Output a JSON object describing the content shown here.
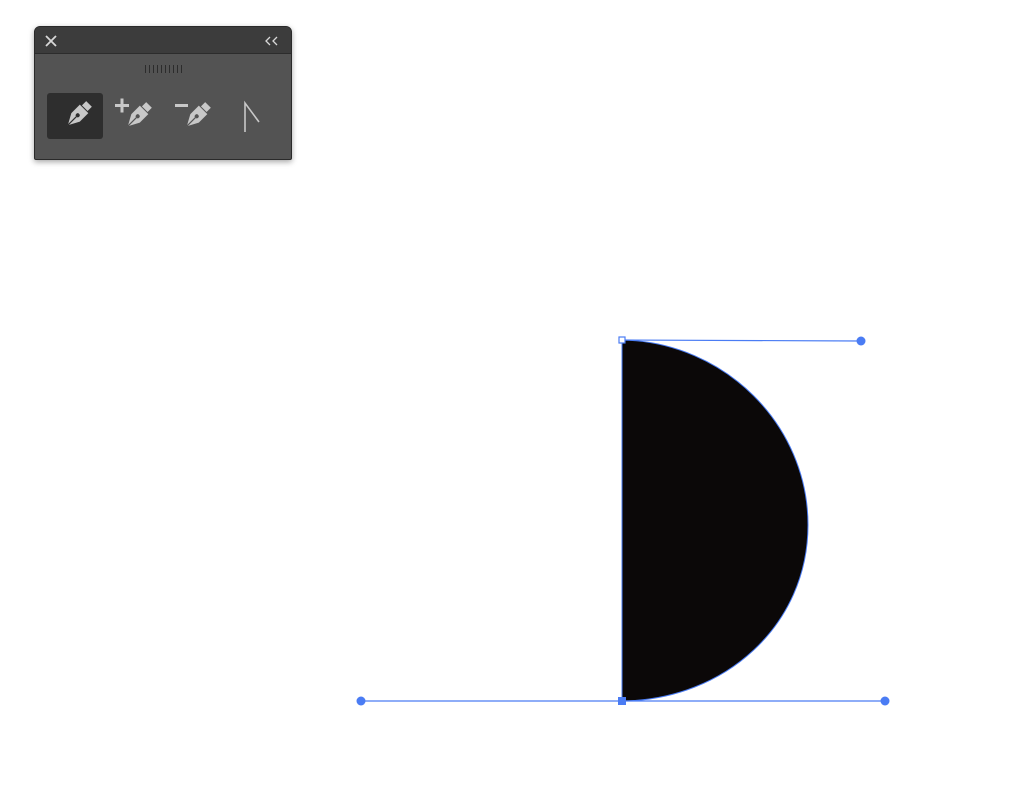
{
  "panel": {
    "close_icon": "close-icon",
    "collapse_icon": "collapse-chevrons-icon",
    "grip_icon": "drag-grip-icon",
    "tools": [
      {
        "name": "pen-tool",
        "icon": "pen-icon",
        "active": true
      },
      {
        "name": "add-anchor-point-tool",
        "icon": "pen-plus-icon",
        "active": false
      },
      {
        "name": "delete-anchor-point-tool",
        "icon": "pen-minus-icon",
        "active": false
      },
      {
        "name": "anchor-point-tool",
        "icon": "convert-anchor-icon",
        "active": false
      }
    ]
  },
  "colors": {
    "panel_bg": "#535353",
    "panel_title_bg": "#3c3c3c",
    "active_tool_bg": "#2e2e2e",
    "icon_color": "#c8c8c8",
    "shape_fill": "#0b0808",
    "selection_blue": "#4a7cf4",
    "canvas_bg": "#ffffff"
  }
}
